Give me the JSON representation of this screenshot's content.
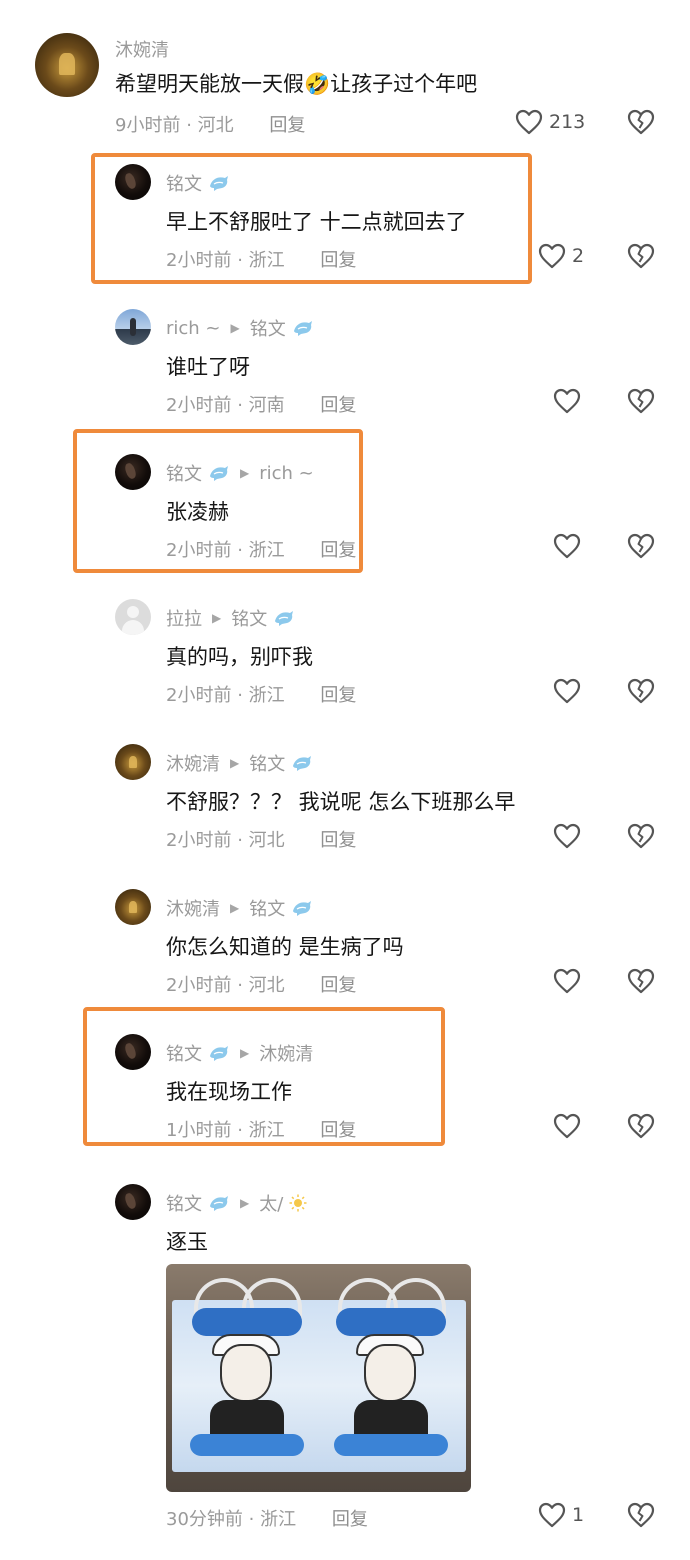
{
  "comments": [
    {
      "author": "沐婉清",
      "text": "希望明天能放一天假🤣让孩子过个年吧",
      "time": "9小时前",
      "location": "河北",
      "reply_label": "回复",
      "likes": "213"
    },
    {
      "author": "铭文",
      "text": "早上不舒服吐了 十二点就回去了",
      "time": "2小时前",
      "location": "浙江",
      "reply_label": "回复",
      "likes": "2"
    },
    {
      "author": "rich ~",
      "reply_to": "铭文",
      "text": "谁吐了呀",
      "time": "2小时前",
      "location": "河南",
      "reply_label": "回复",
      "likes": ""
    },
    {
      "author": "铭文",
      "reply_to": "rich ~",
      "text": "张凌赫",
      "time": "2小时前",
      "location": "浙江",
      "reply_label": "回复",
      "likes": ""
    },
    {
      "author": "拉拉",
      "reply_to": "铭文",
      "text": "真的吗，别吓我",
      "time": "2小时前",
      "location": "浙江",
      "reply_label": "回复",
      "likes": ""
    },
    {
      "author": "沐婉清",
      "reply_to": "铭文",
      "text": "不舒服？？？ 我说呢  怎么下班那么早",
      "time": "2小时前",
      "location": "河北",
      "reply_label": "回复",
      "likes": ""
    },
    {
      "author": "沐婉清",
      "reply_to": "铭文",
      "text": "你怎么知道的  是生病了吗",
      "time": "2小时前",
      "location": "河北",
      "reply_label": "回复",
      "likes": ""
    },
    {
      "author": "铭文",
      "reply_to": "沐婉清",
      "text": "我在现场工作",
      "time": "1小时前",
      "location": "浙江",
      "reply_label": "回复",
      "likes": ""
    },
    {
      "author": "铭文",
      "reply_to": "太/",
      "text": "逐玉",
      "time": "30分钟前",
      "location": "浙江",
      "reply_label": "回复",
      "likes": "1"
    }
  ],
  "meta_separator": "·",
  "colors": {
    "highlight_box": "#ef8a3b",
    "secondary_text": "#9a9a9a",
    "badge_blue": "#7fc3e8"
  },
  "icons": {
    "like": "heart-outline-icon",
    "dislike": "broken-heart-icon",
    "reply_arrow": "triangle-right-icon",
    "badge": "dolphin-badge-icon",
    "sun": "sun-icon"
  }
}
